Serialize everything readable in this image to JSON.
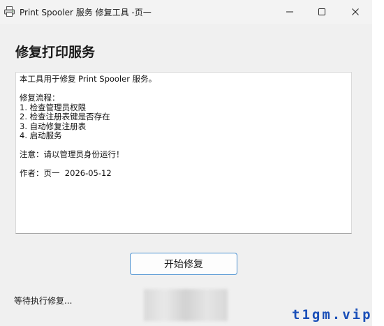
{
  "window": {
    "title": "Print Spooler 服务 修复工具 -页一",
    "icon": "printer-icon",
    "controls": {
      "minimize": "minimize-icon",
      "maximize": "maximize-icon",
      "close": "close-icon"
    }
  },
  "main": {
    "heading": "修复打印服务",
    "description": "本工具用于修复 Print Spooler 服务。\n\n修复流程：\n1. 检查管理员权限\n2. 检查注册表键是否存在\n3. 自动修复注册表\n4. 启动服务\n\n注意：请以管理员身份运行！\n\n作者：页一  2026-05-12",
    "start_button": "开始修复",
    "status": "等待执行修复..."
  },
  "watermark": "t1gm.vip",
  "colors": {
    "accent": "#4a90d0",
    "watermark": "#1a4fb8",
    "window_bg": "#f0f0f0"
  }
}
